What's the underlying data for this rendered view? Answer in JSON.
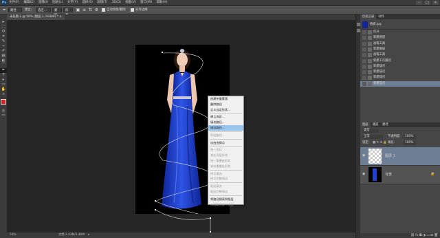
{
  "app": {
    "logo": "Ps"
  },
  "menubar": {
    "items": [
      "文件(F)",
      "编辑(E)",
      "图像(I)",
      "图层(L)",
      "文字(Y)",
      "选择(S)",
      "滤镜(T)",
      "3D(D)",
      "视图(V)",
      "窗口(W)",
      "帮助(H)"
    ],
    "window_controls": [
      "–",
      "□",
      "✕"
    ]
  },
  "options_bar": {
    "tool_icon": "pen-tool-icon",
    "mode": "路径",
    "make_label": "建立:",
    "selection_btn": "选区...",
    "mask_btn": "蒙版",
    "shape_btn": "形状",
    "auto_add_label": "自动添加/删除",
    "align_edges_label": "对齐边缘"
  },
  "document": {
    "tab_title": "未标题-1 @ 50% (图层 1, RGB/8) *",
    "zoom": "50%",
    "doc_info": "文档:2.43M/2.46M"
  },
  "toolbox": {
    "tools": [
      "▸",
      "⬚",
      "ʘ",
      "⌗",
      "✎",
      "⌁",
      "✐",
      "▤",
      "◐",
      "⌒",
      "✒",
      "T",
      "▸",
      "▭",
      "✋",
      "⌕"
    ]
  },
  "context_menu": {
    "items": [
      {
        "label": "创建矢量蒙版",
        "disabled": false
      },
      {
        "label": "删除路径",
        "disabled": false
      },
      {
        "label": "定义自定形状...",
        "disabled": false
      },
      {
        "sep": true
      },
      {
        "label": "建立选区...",
        "disabled": false
      },
      {
        "label": "填充路径...",
        "disabled": false
      },
      {
        "label": "描边路径...",
        "disabled": false,
        "highlight": true
      },
      {
        "sep": true
      },
      {
        "label": "剪贴路径...",
        "disabled": true
      },
      {
        "sep": true
      },
      {
        "label": "自由变换点",
        "disabled": false
      },
      {
        "sep": true
      },
      {
        "label": "统一形状",
        "disabled": true
      },
      {
        "label": "减去顶层形状",
        "disabled": true
      },
      {
        "label": "统一重叠处形状",
        "disabled": true
      },
      {
        "label": "减去重叠处形状",
        "disabled": true
      },
      {
        "sep": true
      },
      {
        "label": "拷贝填充",
        "disabled": true
      },
      {
        "label": "拷贝完整描边",
        "disabled": true
      },
      {
        "sep": true
      },
      {
        "label": "粘贴填充",
        "disabled": true
      },
      {
        "label": "粘贴完整描边",
        "disabled": true
      },
      {
        "sep": true
      },
      {
        "label": "将路径隔离到图层",
        "disabled": false
      },
      {
        "label": "从隔离图层中释放",
        "disabled": true
      }
    ]
  },
  "history_panel": {
    "tabs": [
      "历史记录",
      "动作"
    ],
    "snapshot_label": "春姿.jpg",
    "items": [
      "打开",
      "新建图层",
      "画笔工具",
      "新建图层",
      "画笔工具",
      "新建工作路径",
      "新建锚点",
      "新建锚点",
      "新建锚点",
      "新建锚点"
    ]
  },
  "layers_panel": {
    "tabs": [
      "图层",
      "通道",
      "路径"
    ],
    "kind_label": "类型",
    "blend_mode": "正常",
    "opacity_label": "不透明度:",
    "opacity_value": "100%",
    "lock_label": "锁定:",
    "fill_label": "填充:",
    "fill_value": "100%",
    "layers": [
      {
        "name": "图层 1"
      },
      {
        "name": "背景"
      }
    ]
  },
  "colors": {
    "foreground": "#e02020",
    "background": "#2fbf3f",
    "accent": "#99c4ee",
    "dress": "#1f3fcf"
  }
}
